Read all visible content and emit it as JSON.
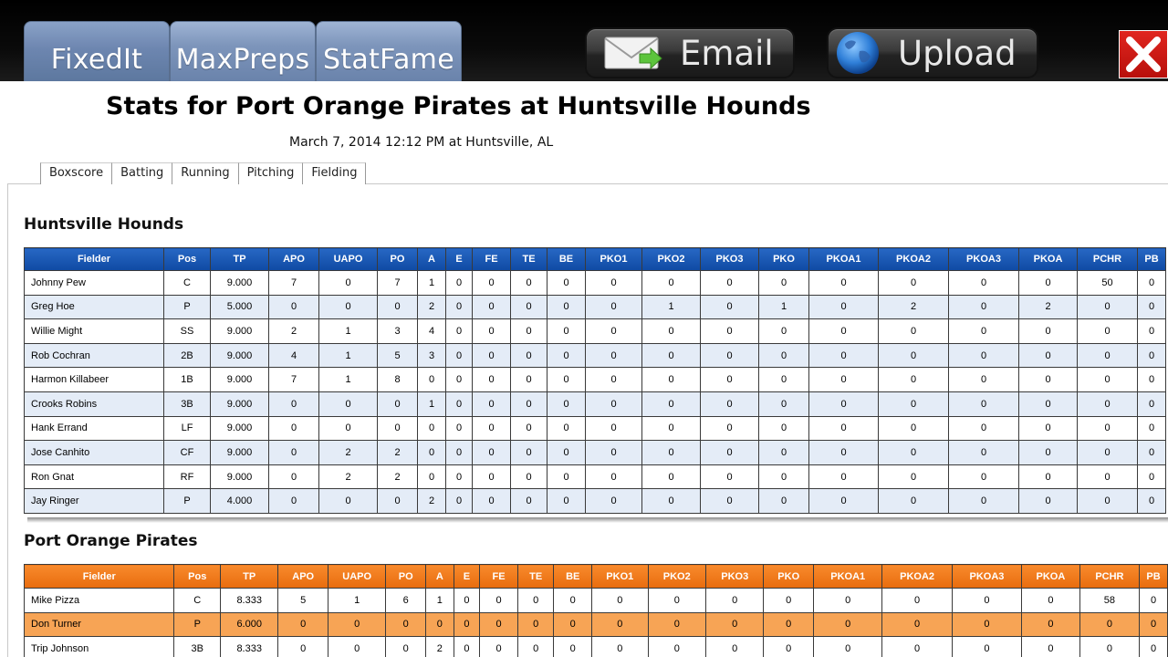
{
  "toolbar": {
    "export_tabs": [
      "FixedIt",
      "MaxPreps",
      "StatFame"
    ],
    "email_label": "Email",
    "upload_label": "Upload"
  },
  "page": {
    "title": "Stats for Port Orange Pirates at Huntsville Hounds",
    "subtitle": "March 7, 2014 12:12 PM at Huntsville, AL"
  },
  "stat_tabs": [
    "Boxscore",
    "Batting",
    "Running",
    "Pitching",
    "Fielding"
  ],
  "columns": [
    "Fielder",
    "Pos",
    "TP",
    "APO",
    "UAPO",
    "PO",
    "A",
    "E",
    "FE",
    "TE",
    "BE",
    "PKO1",
    "PKO2",
    "PKO3",
    "PKO",
    "PKOA1",
    "PKOA2",
    "PKOA3",
    "PKOA",
    "PCHR",
    "PB"
  ],
  "home": {
    "team_name": "Huntsville Hounds",
    "rows": [
      [
        "Johnny Pew",
        "C",
        "9.000",
        "7",
        "0",
        "7",
        "1",
        "0",
        "0",
        "0",
        "0",
        "0",
        "0",
        "0",
        "0",
        "0",
        "0",
        "0",
        "0",
        "50",
        "0"
      ],
      [
        "Greg Hoe",
        "P",
        "5.000",
        "0",
        "0",
        "0",
        "2",
        "0",
        "0",
        "0",
        "0",
        "0",
        "1",
        "0",
        "1",
        "0",
        "2",
        "0",
        "2",
        "0",
        "0"
      ],
      [
        "Willie Might",
        "SS",
        "9.000",
        "2",
        "1",
        "3",
        "4",
        "0",
        "0",
        "0",
        "0",
        "0",
        "0",
        "0",
        "0",
        "0",
        "0",
        "0",
        "0",
        "0",
        "0"
      ],
      [
        "Rob Cochran",
        "2B",
        "9.000",
        "4",
        "1",
        "5",
        "3",
        "0",
        "0",
        "0",
        "0",
        "0",
        "0",
        "0",
        "0",
        "0",
        "0",
        "0",
        "0",
        "0",
        "0"
      ],
      [
        "Harmon Killabeer",
        "1B",
        "9.000",
        "7",
        "1",
        "8",
        "0",
        "0",
        "0",
        "0",
        "0",
        "0",
        "0",
        "0",
        "0",
        "0",
        "0",
        "0",
        "0",
        "0",
        "0"
      ],
      [
        "Crooks Robins",
        "3B",
        "9.000",
        "0",
        "0",
        "0",
        "1",
        "0",
        "0",
        "0",
        "0",
        "0",
        "0",
        "0",
        "0",
        "0",
        "0",
        "0",
        "0",
        "0",
        "0"
      ],
      [
        "Hank Errand",
        "LF",
        "9.000",
        "0",
        "0",
        "0",
        "0",
        "0",
        "0",
        "0",
        "0",
        "0",
        "0",
        "0",
        "0",
        "0",
        "0",
        "0",
        "0",
        "0",
        "0"
      ],
      [
        "Jose Canhito",
        "CF",
        "9.000",
        "0",
        "2",
        "2",
        "0",
        "0",
        "0",
        "0",
        "0",
        "0",
        "0",
        "0",
        "0",
        "0",
        "0",
        "0",
        "0",
        "0",
        "0"
      ],
      [
        "Ron Gnat",
        "RF",
        "9.000",
        "0",
        "2",
        "2",
        "0",
        "0",
        "0",
        "0",
        "0",
        "0",
        "0",
        "0",
        "0",
        "0",
        "0",
        "0",
        "0",
        "0",
        "0"
      ],
      [
        "Jay Ringer",
        "P",
        "4.000",
        "0",
        "0",
        "0",
        "2",
        "0",
        "0",
        "0",
        "0",
        "0",
        "0",
        "0",
        "0",
        "0",
        "0",
        "0",
        "0",
        "0",
        "0"
      ]
    ]
  },
  "away": {
    "team_name": "Port Orange Pirates",
    "rows": [
      [
        "Mike Pizza",
        "C",
        "8.333",
        "5",
        "1",
        "6",
        "1",
        "0",
        "0",
        "0",
        "0",
        "0",
        "0",
        "0",
        "0",
        "0",
        "0",
        "0",
        "0",
        "58",
        "0"
      ],
      [
        "Don Turner",
        "P",
        "6.000",
        "0",
        "0",
        "0",
        "0",
        "0",
        "0",
        "0",
        "0",
        "0",
        "0",
        "0",
        "0",
        "0",
        "0",
        "0",
        "0",
        "0",
        "0"
      ],
      [
        "Trip Johnson",
        "3B",
        "8.333",
        "0",
        "0",
        "0",
        "2",
        "0",
        "0",
        "0",
        "0",
        "0",
        "0",
        "0",
        "0",
        "0",
        "0",
        "0",
        "0",
        "0",
        "0"
      ]
    ]
  },
  "colors": {
    "home_header": "#1d5cb8",
    "away_header": "#f07a1c",
    "home_alt_row": "#e4ecf7",
    "away_alt_row": "#f7a455",
    "close_button": "#d01a14"
  },
  "icons": {
    "email": "envelope-icon",
    "upload": "globe-icon",
    "close": "close-icon"
  }
}
